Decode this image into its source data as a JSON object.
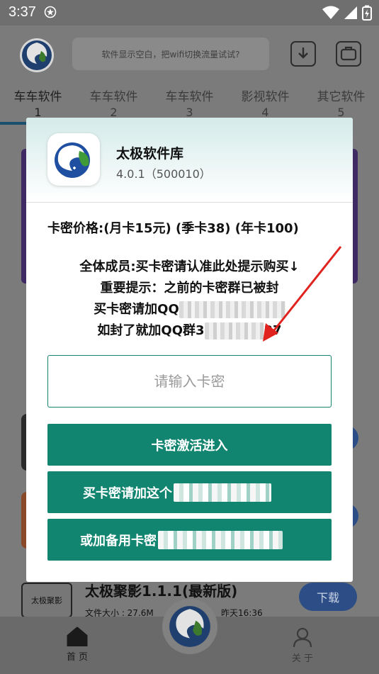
{
  "status_bar": {
    "time": "3:37"
  },
  "header": {
    "search_placeholder": "软件显示空白，把wifi切换流量试试?"
  },
  "tabs": [
    {
      "label": "车车软件",
      "num": "1"
    },
    {
      "label": "车车软件",
      "num": "2"
    },
    {
      "label": "车车软件",
      "num": "3"
    },
    {
      "label": "影视软件",
      "num": "4"
    },
    {
      "label": "其它软件",
      "num": "5"
    }
  ],
  "background_item": {
    "icon_text": "太极聚影",
    "title": "太极聚影1.1.1(最新版)",
    "size": "文件大小 : 27.6M",
    "date": "昨天16:36",
    "download": "下载"
  },
  "bottom_nav": {
    "home": "首 页",
    "about": "关 于"
  },
  "dialog": {
    "app_name": "太极软件库",
    "app_version": "4.0.1（500010）",
    "price_line": "卡密价格:(月卡15元) (季卡38) (年卡100)",
    "notice": {
      "line1": "全体成员:买卡密请认准此处提示购买↓",
      "line2": "重要提示：之前的卡密群已被封",
      "line3_prefix": "买卡密请加QQ",
      "line4_prefix": "如封了就加QQ群3",
      "line4_suffix": "37"
    },
    "input_placeholder": "请输入卡密",
    "buttons": {
      "activate": "卡密激活进入",
      "buy_prefix": "买卡密请加这个",
      "backup_prefix": "或加备用卡密"
    }
  },
  "colors": {
    "primary": "#128570",
    "accent_arrow": "#e0231f"
  }
}
